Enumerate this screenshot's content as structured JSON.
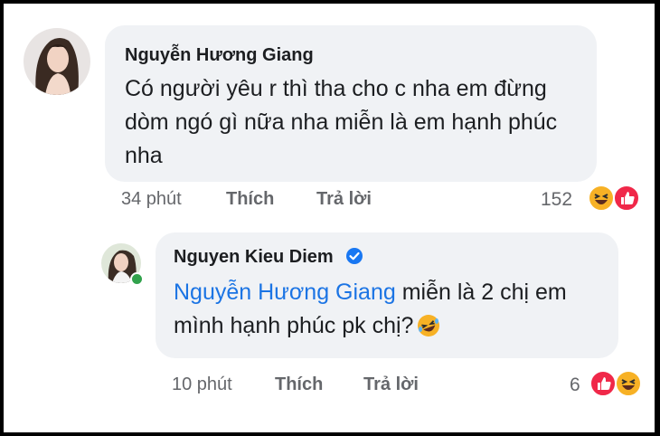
{
  "comment1": {
    "author": "Nguyễn Hương Giang",
    "text": "Có người yêu r thì tha cho c nha em đừng dòm ngó gì nữa nha miễn là em hạnh phúc nha",
    "time": "34 phút",
    "like_label": "Thích",
    "reply_label": "Trả lời",
    "reaction_count": "152",
    "reactions": [
      "haha-icon",
      "like-icon"
    ]
  },
  "comment2": {
    "author": "Nguyen Kieu Diem",
    "mention": "Nguyễn Hương Giang",
    "text": " miễn là 2 chị em mình hạnh phúc pk chị?",
    "emoji": "laughing-face-emoji",
    "time": "10 phút",
    "like_label": "Thích",
    "reply_label": "Trả lời",
    "reaction_count": "6",
    "reactions": [
      "like-icon",
      "haha-icon"
    ]
  },
  "colors": {
    "bubble": "#f0f2f5",
    "mention": "#1b74e4",
    "like": "#f02849",
    "haha": "#f7b125",
    "verified": "#1877f2",
    "online": "#31a24c"
  }
}
